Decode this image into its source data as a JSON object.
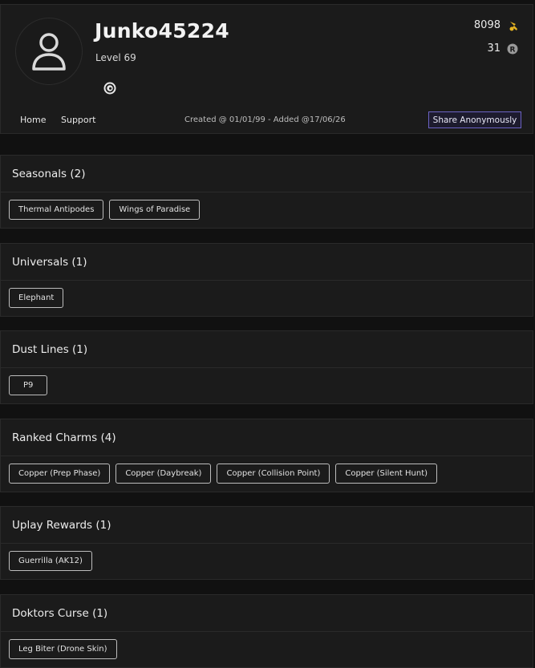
{
  "profile": {
    "username": "Junko45224",
    "level": "Level 69",
    "stats": [
      {
        "value": "8098",
        "icon": "renown-icon"
      },
      {
        "value": "31",
        "icon": "r6-credits-icon"
      }
    ],
    "platform_icon": "ubisoft-icon",
    "nav": {
      "home": "Home",
      "support": "Support"
    },
    "created": "Created @ 01/01/99 - Added @17/06/26",
    "share_label": "Share Anonymously"
  },
  "colors": {
    "background": "#111111",
    "panel": "#1b1b1b",
    "accent": "#6c63c4",
    "renown": "#e6b422"
  },
  "sections": [
    {
      "title": "Seasonals (2)",
      "items": [
        "Thermal Antipodes",
        "Wings of Paradise"
      ]
    },
    {
      "title": "Universals (1)",
      "items": [
        "Elephant"
      ]
    },
    {
      "title": "Dust Lines (1)",
      "items": [
        "P9"
      ]
    },
    {
      "title": "Ranked Charms (4)",
      "items": [
        "Copper (Prep Phase)",
        "Copper (Daybreak)",
        "Copper (Collision Point)",
        "Copper (Silent Hunt)"
      ]
    },
    {
      "title": "Uplay Rewards (1)",
      "items": [
        "Guerrilla (AK12)"
      ]
    },
    {
      "title": "Doktors Curse (1)",
      "items": [
        "Leg Biter (Drone Skin)"
      ]
    }
  ]
}
